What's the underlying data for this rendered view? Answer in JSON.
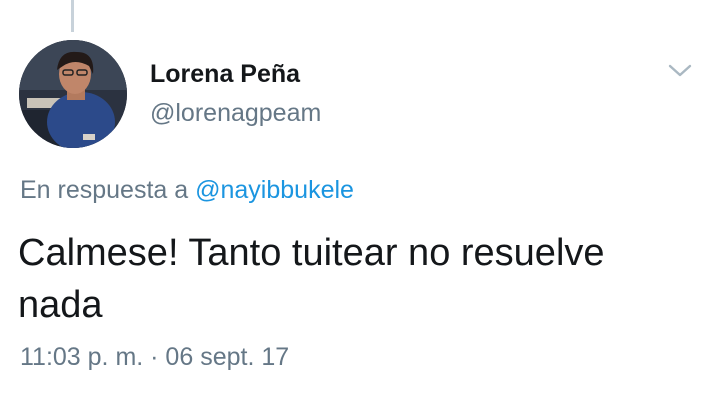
{
  "tweet": {
    "author": {
      "display_name": "Lorena Peña",
      "handle": "@lorenagpeam"
    },
    "reply_prefix": "En respuesta a",
    "reply_to": "@nayibbukele",
    "text": "Calmese! Tanto tuitear no resuelve nada",
    "timestamp": "11:03 p. m. · 06 sept. 17"
  },
  "icons": {
    "menu": "chevron-down-icon"
  },
  "colors": {
    "mention": "#1b95e0",
    "secondary_text": "#657786",
    "primary_text": "#14171a"
  }
}
